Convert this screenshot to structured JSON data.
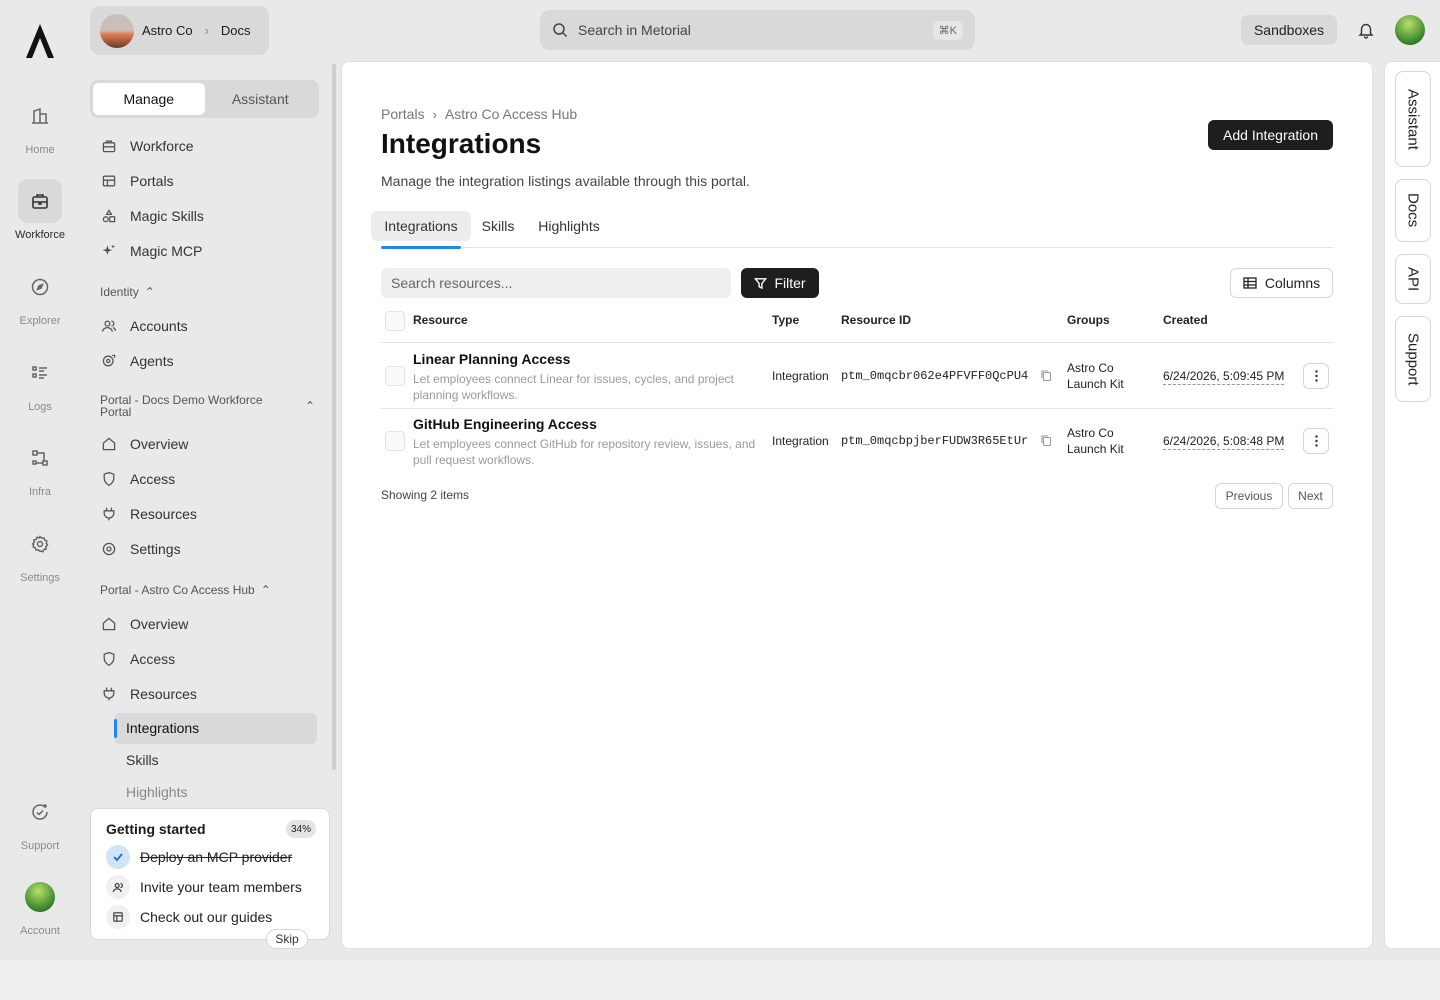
{
  "topbar": {
    "org_name": "Astro Co",
    "org_section": "Docs",
    "search_placeholder": "Search in Metorial",
    "search_shortcut": "⌘K",
    "sandboxes_label": "Sandboxes"
  },
  "rail": {
    "items": [
      {
        "label": "Home"
      },
      {
        "label": "Workforce"
      },
      {
        "label": "Explorer"
      },
      {
        "label": "Logs"
      },
      {
        "label": "Infra"
      },
      {
        "label": "Settings"
      },
      {
        "label": "Support"
      },
      {
        "label": "Account"
      }
    ]
  },
  "sidebar": {
    "tabs": [
      {
        "label": "Manage"
      },
      {
        "label": "Assistant"
      }
    ],
    "main_items": [
      {
        "label": "Workforce"
      },
      {
        "label": "Portals"
      },
      {
        "label": "Magic Skills"
      },
      {
        "label": "Magic MCP"
      }
    ],
    "identity_section": "Identity",
    "identity_items": [
      {
        "label": "Accounts"
      },
      {
        "label": "Agents"
      }
    ],
    "portal1_section": "Portal - Docs Demo Workforce Portal",
    "portal1_items": [
      {
        "label": "Overview"
      },
      {
        "label": "Access"
      },
      {
        "label": "Resources"
      },
      {
        "label": "Settings"
      }
    ],
    "portal2_section": "Portal - Astro Co Access Hub",
    "portal2_items": [
      {
        "label": "Overview"
      },
      {
        "label": "Access"
      },
      {
        "label": "Resources"
      }
    ],
    "resource_subitems": [
      {
        "label": "Integrations"
      },
      {
        "label": "Skills"
      },
      {
        "label": "Highlights"
      }
    ]
  },
  "getting_started": {
    "title": "Getting started",
    "progress": "34%",
    "tasks": [
      {
        "label": "Deploy an MCP provider",
        "done": true
      },
      {
        "label": "Invite your team members",
        "done": false
      },
      {
        "label": "Check out our guides",
        "done": false
      }
    ],
    "skip_label": "Skip"
  },
  "page": {
    "breadcrumb": [
      "Portals",
      "Astro Co Access Hub"
    ],
    "title": "Integrations",
    "description": "Manage the integration listings available through this portal.",
    "add_button": "Add Integration",
    "tabs": [
      {
        "label": "Integrations"
      },
      {
        "label": "Skills"
      },
      {
        "label": "Highlights"
      }
    ],
    "search_placeholder": "Search resources...",
    "filter_label": "Filter",
    "columns_label": "Columns",
    "table": {
      "headers": [
        "Resource",
        "Type",
        "Resource ID",
        "Groups",
        "Created"
      ],
      "rows": [
        {
          "title": "Linear Planning Access",
          "description": "Let employees connect Linear for issues, cycles, and project planning workflows.",
          "type": "Integration",
          "resource_id": "ptm_0mqcbr062e4PFVFF0QcPU4",
          "group_line1": "Astro Co",
          "group_line2": "Launch Kit",
          "created": "6/24/2026, 5:09:45 PM"
        },
        {
          "title": "GitHub Engineering Access",
          "description": "Let employees connect GitHub for repository review, issues, and pull request workflows.",
          "type": "Integration",
          "resource_id": "ptm_0mqcbpjberFUDW3R65EtUr",
          "group_line1": "Astro Co",
          "group_line2": "Launch Kit",
          "created": "6/24/2026, 5:08:48 PM"
        }
      ]
    },
    "showing": "Showing 2 items",
    "prev_label": "Previous",
    "next_label": "Next"
  },
  "right_tabs": [
    {
      "label": "Assistant"
    },
    {
      "label": "Docs"
    },
    {
      "label": "API"
    },
    {
      "label": "Support"
    }
  ],
  "colors": {
    "accent": "#1e88f0",
    "dark_button": "#1e1e1e",
    "background": "#e9e9ea"
  }
}
